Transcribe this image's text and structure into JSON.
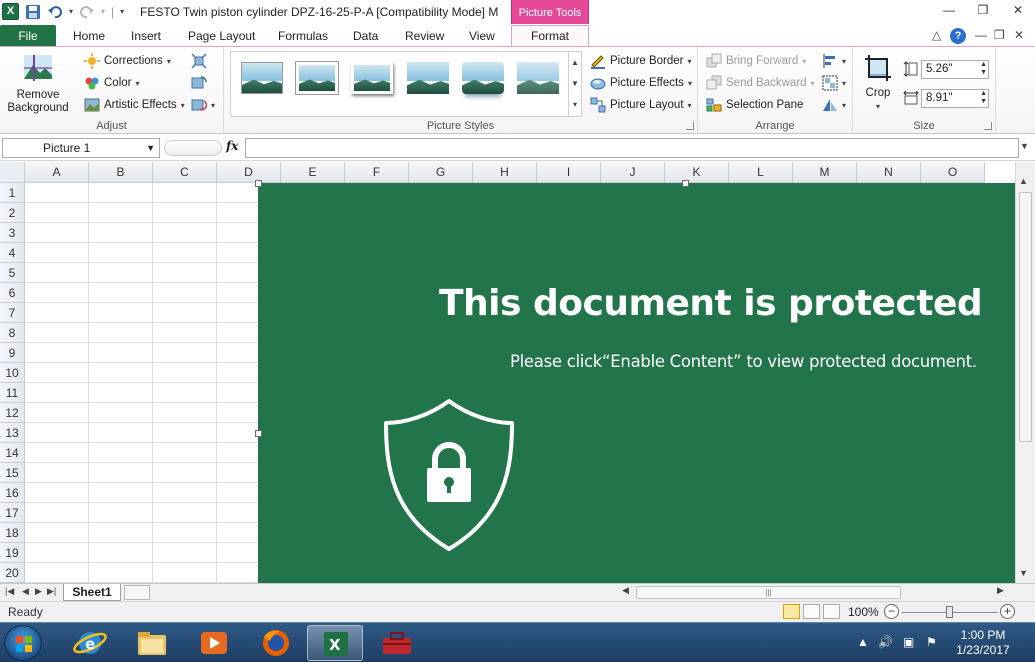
{
  "window": {
    "title": "FESTO Twin piston cylinder DPZ-16-25-P-A  [Compatibility Mode] M",
    "context_tab_group": "Picture Tools",
    "app_icon_letter": "X"
  },
  "tabs": {
    "file": "File",
    "items": [
      "Home",
      "Insert",
      "Page Layout",
      "Formulas",
      "Data",
      "Review",
      "View"
    ],
    "active_context": "Format"
  },
  "ribbon": {
    "adjust": {
      "label": "Adjust",
      "remove_background_line1": "Remove",
      "remove_background_line2": "Background",
      "corrections": "Corrections",
      "color": "Color",
      "artistic_effects": "Artistic Effects"
    },
    "picture_styles": {
      "label": "Picture Styles",
      "picture_border": "Picture Border",
      "picture_effects": "Picture Effects",
      "picture_layout": "Picture Layout"
    },
    "arrange": {
      "label": "Arrange",
      "bring_forward": "Bring Forward",
      "send_backward": "Send Backward",
      "selection_pane": "Selection Pane"
    },
    "size": {
      "label": "Size",
      "crop": "Crop",
      "height": "5.26\"",
      "width": "8.91\""
    }
  },
  "formula_bar": {
    "name_box": "Picture 1",
    "fx": "fx",
    "formula": ""
  },
  "grid": {
    "columns": [
      "A",
      "B",
      "C",
      "D",
      "E",
      "F",
      "G",
      "H",
      "I",
      "J",
      "K",
      "L",
      "M",
      "N",
      "O"
    ],
    "rows": [
      "1",
      "2",
      "3",
      "4",
      "5",
      "6",
      "7",
      "8",
      "9",
      "10",
      "11",
      "12",
      "13",
      "14",
      "15",
      "16",
      "17",
      "18",
      "19",
      "20"
    ]
  },
  "picture": {
    "title": "This document is protected",
    "subtitle": "Please click“Enable Content” to view protected document.",
    "background_color": "#22744a",
    "icon": "shield-lock-icon"
  },
  "sheets": {
    "tabs": [
      "Sheet1"
    ]
  },
  "status": {
    "ready": "Ready",
    "zoom": "100%"
  },
  "taskbar": {
    "time": "1:00 PM",
    "date": "1/23/2017"
  },
  "colors": {
    "excel_green": "#217346",
    "picture_tools_pink": "#e64997",
    "taskbar_blue": "#2f5a86"
  }
}
